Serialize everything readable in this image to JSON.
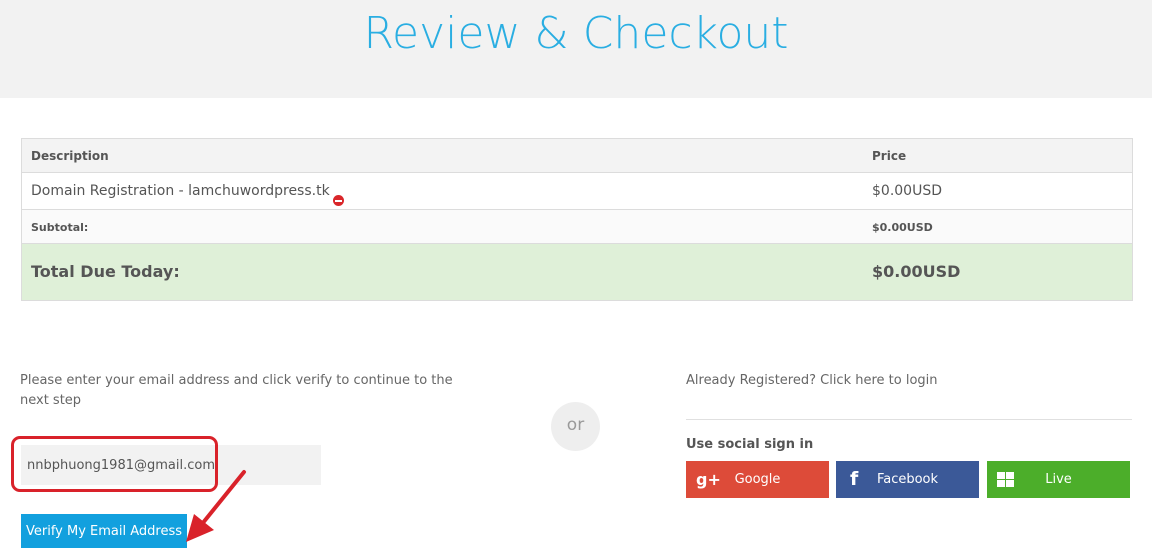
{
  "header": {
    "title": "Review & Checkout"
  },
  "cart": {
    "headers": {
      "description": "Description",
      "price": "Price"
    },
    "items": [
      {
        "description": "Domain Registration - lamchuwordpress.tk",
        "price": "$0.00USD",
        "icon": "remove-icon"
      }
    ],
    "subtotal": {
      "label": "Subtotal:",
      "value": "$0.00USD"
    },
    "total": {
      "label": "Total Due Today:",
      "value": "$0.00USD"
    }
  },
  "verify": {
    "instruction": "Please enter your email address and click verify to continue to the next step",
    "email_value": "nnbphuong1981@gmail.com",
    "button_label": "Verify My Email Address"
  },
  "separator": {
    "label": "or"
  },
  "login": {
    "link_text": "Already Registered? Click here to login",
    "social_title": "Use social sign in",
    "buttons": [
      {
        "label": "Google",
        "icon": "google-plus-icon",
        "color": "#dd4b39"
      },
      {
        "label": "Facebook",
        "icon": "facebook-icon",
        "color": "#3b5998"
      },
      {
        "label": "Live",
        "icon": "windows-icon",
        "color": "#4cae2a"
      }
    ]
  },
  "colors": {
    "accent": "#2aaee2",
    "verify_button": "#12a0de",
    "total_row": "#dff0d8",
    "annotation": "#d9222a"
  }
}
